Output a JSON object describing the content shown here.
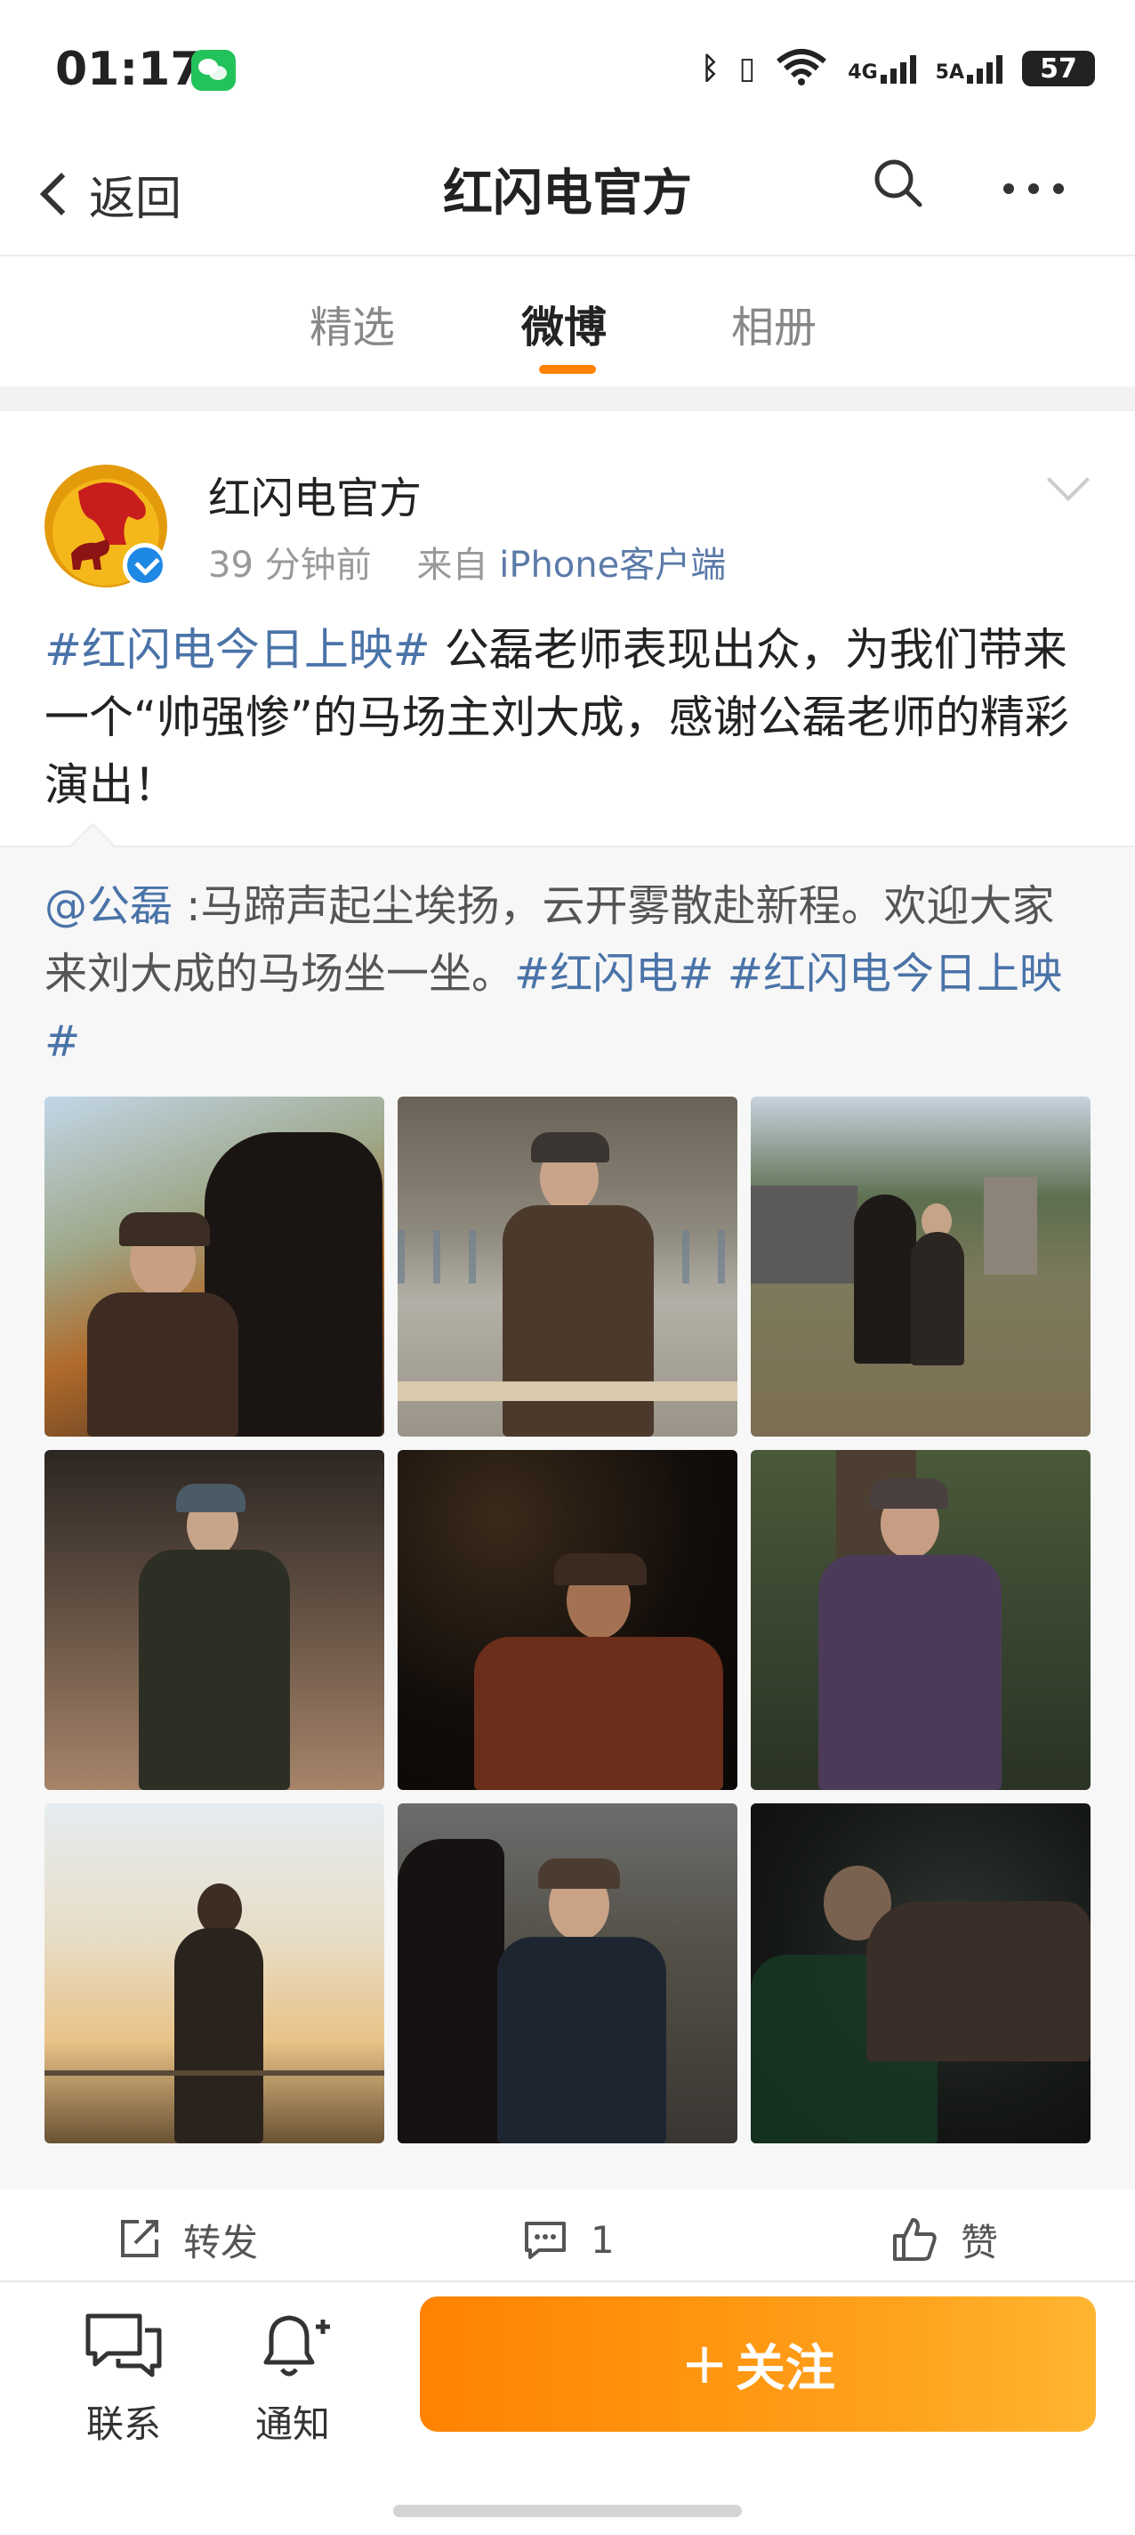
{
  "status_bar": {
    "time": "01:17",
    "battery": "57",
    "net_4g": "4G",
    "net_5a": "5A",
    "wifi_label": "6"
  },
  "nav": {
    "back_label": "返回",
    "title": "红闪电官方"
  },
  "tabs": [
    {
      "label": "精选"
    },
    {
      "label": "微博"
    },
    {
      "label": "相册"
    }
  ],
  "post": {
    "author": "红闪电官方",
    "time_ago": "39 分钟前",
    "from_prefix": "来自",
    "source": "iPhone客户端",
    "topic": "#红闪电今日上映#",
    "text": " 公磊老师表现出众，为我们带来一个“帅强惨”的马场主刘大成，感谢公磊老师的精彩演出！"
  },
  "repost": {
    "mention": "@公磊",
    "text": " :马蹄声起尘埃扬，云开雾散赴新程。欢迎大家来刘大成的马场坐一坐。",
    "topic1": "#红闪电#",
    "topic2": "#红闪电今日上映#"
  },
  "actions": {
    "repost_label": "转发",
    "comment_count": "1",
    "like_label": "赞"
  },
  "bottom_bar": {
    "contact_label": "联系",
    "notify_label": "通知",
    "follow_label": "关注"
  },
  "colors": {
    "accent": "#ff8200",
    "link": "#4a73a8",
    "verified": "#1e88e5"
  }
}
